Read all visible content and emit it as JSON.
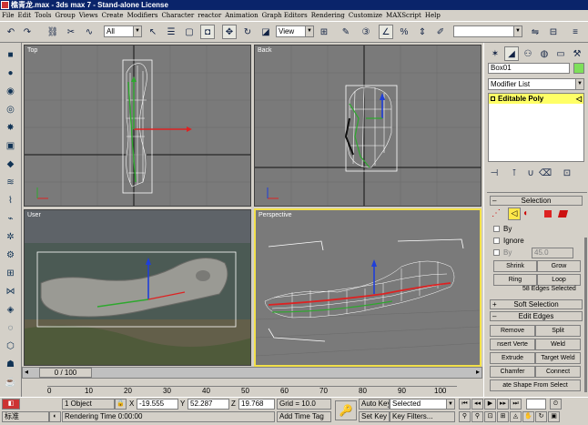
{
  "window": {
    "title": "樵青龙.max - 3ds max 7 - Stand-alone License"
  },
  "menu": [
    "File",
    "Edit",
    "Tools",
    "Group",
    "Views",
    "Create",
    "Modifiers",
    "Character",
    "reactor",
    "Animation",
    "Graph Editors",
    "Rendering",
    "Customize",
    "MAXScript",
    "Help"
  ],
  "toolbar": {
    "selection_filter": "All",
    "ref_coord": "View",
    "named_sel": ""
  },
  "viewports": {
    "top": "Top",
    "back": "Back",
    "user": "User",
    "perspective": "Perspective"
  },
  "command_panel": {
    "object_name": "Box01",
    "object_color": "#7ee05a",
    "modifier_list": "Modifier List",
    "stack_item": "Editable Poly",
    "selection_title": "Selection",
    "by_vertex": "By",
    "ignore_backfacing": "Ignore",
    "by_angle": "By",
    "angle_value": "45.0",
    "shrink": "Shrink",
    "grow": "Grow",
    "ring": "Ring",
    "loop": "Loop",
    "status": "58 Edges Selected",
    "soft_selection": "Soft Selection",
    "edit_edges": "Edit Edges",
    "remove": "Remove",
    "split": "Split",
    "insert_vertex": "nsert Verte",
    "weld": "Weld",
    "extrude": "Extrude",
    "target_weld": "Target Weld",
    "chamfer": "Chamfer",
    "connect": "Connect",
    "create_shape": "ate Shape From Select"
  },
  "timeline": {
    "frame": "0 / 100",
    "ticks": [
      "0",
      "10",
      "20",
      "30",
      "40",
      "50",
      "60",
      "70",
      "80",
      "90",
      "100"
    ]
  },
  "status": {
    "selection": "1 Object",
    "x": "-19.555",
    "y": "52.287",
    "z": "19.768",
    "grid": "Grid = 10.0",
    "auto_key": "Auto Key",
    "set_key": "Set Key",
    "key_mode": "Selected",
    "key_filters": "Key Filters...",
    "ime": "标准",
    "render_time": "Rendering Time  0:00:00",
    "add_time_tag": "Add Time Tag"
  }
}
